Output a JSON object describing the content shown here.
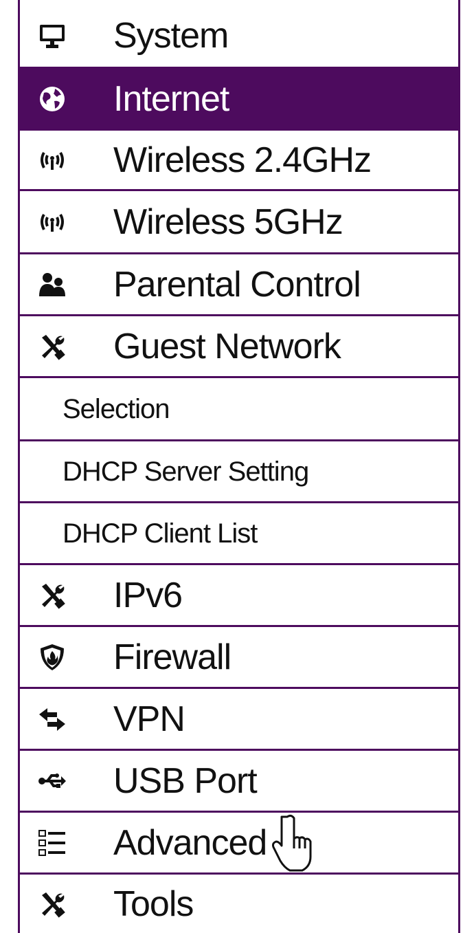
{
  "menu": {
    "items": [
      {
        "label": "System",
        "icon": "monitor-icon"
      },
      {
        "label": "Internet",
        "icon": "globe-icon",
        "active": true
      },
      {
        "label": "Wireless 2.4GHz",
        "icon": "wireless-icon"
      },
      {
        "label": "Wireless 5GHz",
        "icon": "wireless-icon"
      },
      {
        "label": "Parental Control",
        "icon": "users-icon"
      },
      {
        "label": "Guest Network",
        "icon": "tools-icon"
      },
      {
        "label": "Selection",
        "sub": true
      },
      {
        "label": "DHCP Server Setting",
        "sub": true
      },
      {
        "label": "DHCP Client List",
        "sub": true
      },
      {
        "label": "IPv6",
        "icon": "tools-icon"
      },
      {
        "label": "Firewall",
        "icon": "firewall-icon"
      },
      {
        "label": "VPN",
        "icon": "vpn-arrows-icon"
      },
      {
        "label": "USB Port",
        "icon": "usb-icon"
      },
      {
        "label": "Advanced",
        "icon": "list-icon"
      },
      {
        "label": "Tools",
        "icon": "tools-icon"
      }
    ]
  },
  "colors": {
    "accent": "#4d0b5e",
    "text": "#111111",
    "active_text": "#ffffff"
  }
}
